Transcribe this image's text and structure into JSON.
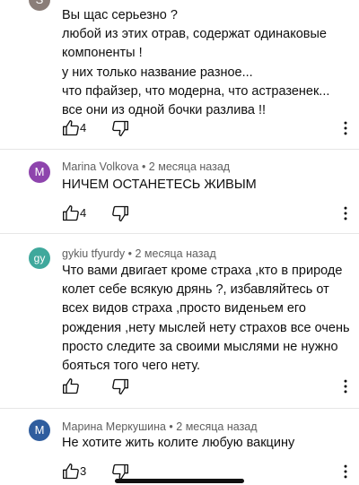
{
  "colors": {
    "avatar_s": "#8a7d78",
    "avatar_m_purple": "#8e44ad",
    "avatar_gy": "#3fa89c",
    "avatar_m_blue": "#2f5d9e"
  },
  "comments": [
    {
      "avatar_letter": "S",
      "lines": [
        "Вы щас серьезно ?",
        "любой из этих отрав, содержат одинаковые",
        "компоненты !",
        "у них только название разное...",
        "что пфайзер, что модерна, что астразенек...",
        "все они из одной бочки разлива !!"
      ],
      "likes": "4"
    },
    {
      "avatar_letter": "M",
      "author": "Marina Volkova",
      "time": "2 месяца назад",
      "lines": [
        "НИЧЕМ ОСТАНЕТЕСЬ ЖИВЫМ"
      ],
      "likes": "4"
    },
    {
      "avatar_letter": "gy",
      "author": "gykiu tfyurdy",
      "time": "2 месяца назад",
      "lines": [
        "Что вами двигает кроме страха ,кто в природе",
        "колет себе всякую дрянь ?,  избавляйтесь от",
        "всех видов страха ,просто виденьем его",
        "рождения ,нету мыслей нету страхов все очень",
        "просто следите за своими мыслями не нужно",
        "бояться того чего нету."
      ],
      "likes": ""
    },
    {
      "avatar_letter": "M",
      "author": "Марина Меркушина",
      "time": "2 месяца назад",
      "lines": [
        "Не хотите жить колите любую вакцину"
      ],
      "likes": "3"
    }
  ],
  "separator": " • "
}
